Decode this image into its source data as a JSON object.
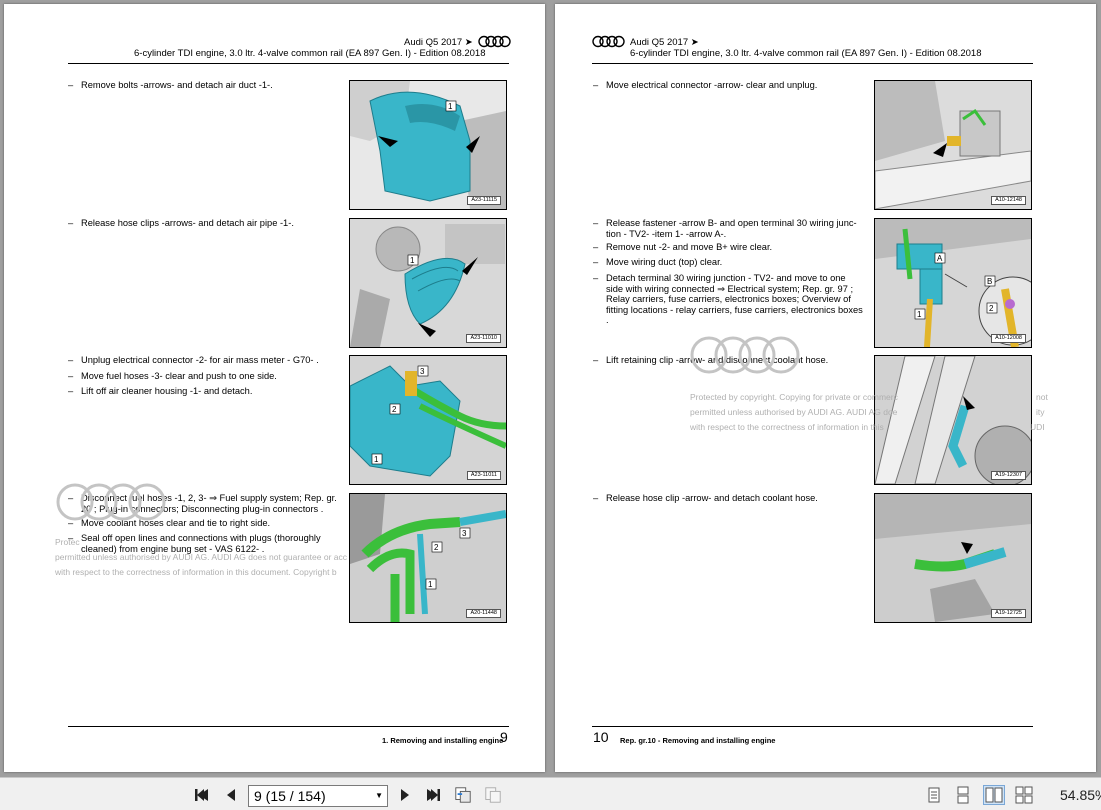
{
  "header": {
    "model": "Audi Q5 2017 ➤",
    "engine": "6-cylinder TDI engine, 3.0 ltr. 4-valve common rail (EA 897 Gen. I) - Edition 08.2018"
  },
  "left_page": {
    "steps": [
      "Remove bolts -arrows- and detach air duct -1-.",
      "Release hose clips -arrows- and detach air pipe -1-.",
      "Unplug electrical connector -2- for air mass meter - G70- .",
      "Move fuel hoses -3- clear and push to one side.",
      "Lift off air cleaner housing -1- and detach.",
      "Disconnect fuel hoses -1, 2, 3- ⇒ Fuel supply system; Rep. gr. 20 ; Plug-in connectors; Disconnecting plug-in connectors .",
      "Move coolant hoses clear and tie to right side.",
      "Seal off open lines and connections with plugs (thoroughly cleaned) from engine bung set - VAS 6122- ."
    ],
    "figures": [
      "A23-11115",
      "A23-11010",
      "A23-11011",
      "A20-11448"
    ],
    "footer_title": "1. Removing and installing engine",
    "page_number": "9"
  },
  "right_page": {
    "steps": [
      "Move electrical connector -arrow- clear and unplug.",
      "Release fastener -arrow B- and open terminal 30 wiring junc- tion - TV2- -item 1- -arrow A-.",
      "Remove nut -2- and move B+ wire clear.",
      "Move wiring duct (top) clear.",
      "Detach terminal 30 wiring junction - TV2- and move to one side with wiring connected ⇒ Electrical system; Rep. gr. 97 ; Relay carriers, fuse carriers, electronics boxes; Overview of fitting locations - relay carriers, fuse carriers, electronics boxes .",
      "Lift retaining clip -arrow- and disconnect coolant hose.",
      "Release hose clip -arrow- and detach coolant hose."
    ],
    "figures": [
      "A10-12148",
      "A10-12008",
      "A19-12307",
      "A19-12725"
    ],
    "footer_page_number": "10",
    "footer_title": "Rep. gr.10 - Removing and installing engine"
  },
  "watermark": {
    "left_lines": [
      "Protec",
      "permitted unless authorised by AUDI AG. AUDI AG does not guarantee or acc",
      "with respect to the correctness of information in this document. Copyright b"
    ],
    "right_lines": [
      "Protected by copyright. Copying for private or commerc",
      "permitted unless authorised by AUDI AG. AUDI AG doe",
      "with respect to the correctness of information in this"
    ],
    "right_tail": [
      "not",
      "ity",
      "UDI"
    ]
  },
  "toolbar": {
    "page_field": "9 (15 / 154)",
    "zoom": "54.85%"
  },
  "icons": {
    "first": "first-page-icon",
    "prev": "prev-page-icon",
    "next": "next-page-icon",
    "last": "last-page-icon"
  },
  "colors": {
    "part_cyan": "#39b6c9",
    "hose_green": "#3bbf3b",
    "connector_yellow": "#e2b52a",
    "background_gray": "#9f9f9f"
  }
}
